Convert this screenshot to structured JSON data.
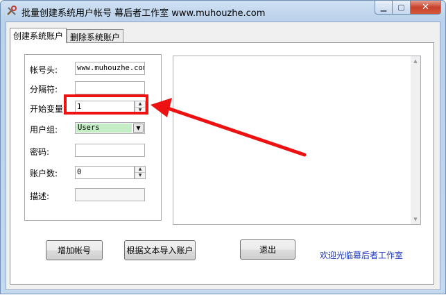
{
  "window": {
    "title": "批量创建系统用户帐号  幕后者工作室  www.muhouzhe.com",
    "icon": "tools-icon",
    "controls": {
      "minimize": "▁",
      "maximize": "▢",
      "close": "✕"
    }
  },
  "tabs": [
    {
      "label": "创建系统账户",
      "active": true
    },
    {
      "label": "删除系统账户",
      "active": false
    }
  ],
  "form": {
    "account_prefix": {
      "label": "帐号头:",
      "value": "www.muhouzhe.com"
    },
    "separator": {
      "label": "分隔符:",
      "value": ""
    },
    "start_var": {
      "label": "开始变量:",
      "value": "1"
    },
    "user_group": {
      "label": "用户组:",
      "value": "Users"
    },
    "password": {
      "label": "密码:",
      "value": ""
    },
    "account_count": {
      "label": "账户数:",
      "value": "0"
    },
    "description": {
      "label": "描述:",
      "value": ""
    }
  },
  "buttons": {
    "add_account": "增加帐号",
    "import_from_text": "根据文本导入账户",
    "exit": "退出"
  },
  "welcome_text": "欢迎光临幕后者工作室",
  "colors": {
    "highlight": "#ee1111",
    "welcome": "#1b36b8",
    "combo_selected": "#c6eec6"
  }
}
